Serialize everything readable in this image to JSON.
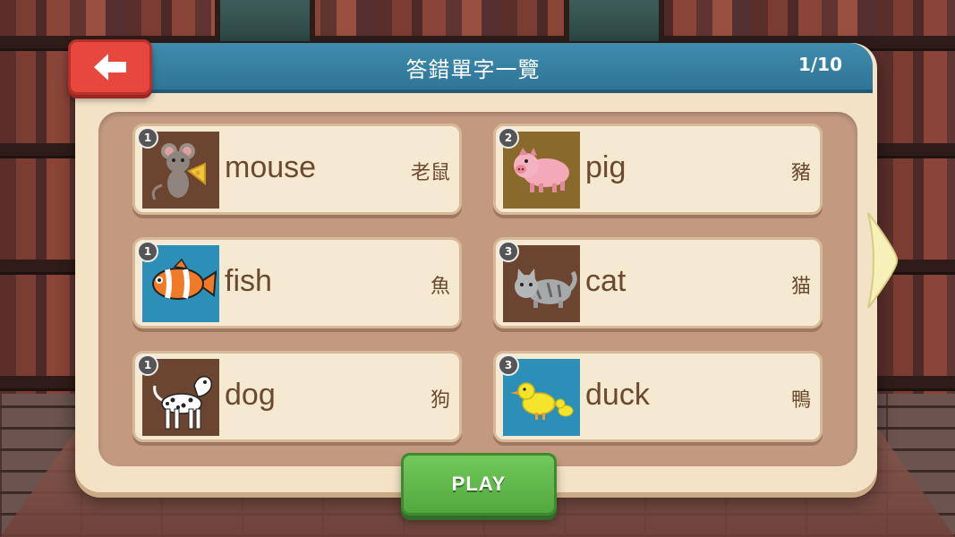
{
  "header": {
    "title": "答錯單字一覽",
    "page_counter": "1/10"
  },
  "buttons": {
    "play_label": "PLAY"
  },
  "cards": [
    {
      "badge": "1",
      "word": "mouse",
      "meaning": "老鼠",
      "icon": "mouse-icon",
      "bg": "#6b4530"
    },
    {
      "badge": "2",
      "word": "pig",
      "meaning": "豬",
      "icon": "pig-icon",
      "bg": "#8a6a2c"
    },
    {
      "badge": "1",
      "word": "fish",
      "meaning": "魚",
      "icon": "fish-icon",
      "bg": "#2c8fb8"
    },
    {
      "badge": "3",
      "word": "cat",
      "meaning": "猫",
      "icon": "cat-icon",
      "bg": "#6b4530"
    },
    {
      "badge": "1",
      "word": "dog",
      "meaning": "狗",
      "icon": "dog-icon",
      "bg": "#6b4530"
    },
    {
      "badge": "3",
      "word": "duck",
      "meaning": "鴨",
      "icon": "duck-icon",
      "bg": "#2c8fb8"
    }
  ],
  "colors": {
    "header": "#2f7597",
    "back": "#e8473d",
    "play": "#52a83d",
    "panel": "#f3e2c6"
  }
}
